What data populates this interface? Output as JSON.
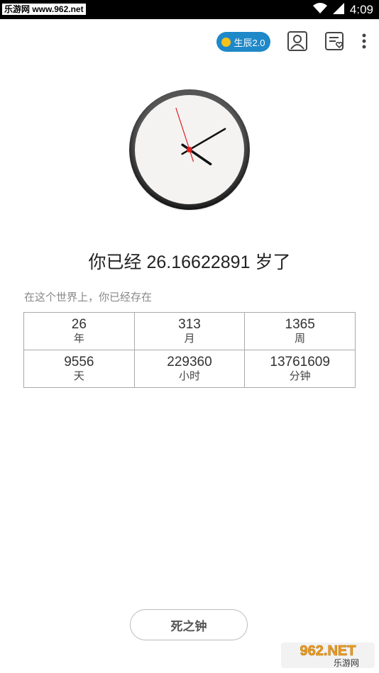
{
  "status_bar": {
    "source_label": "乐游网 www.962.net",
    "time": "4:09"
  },
  "toolbar": {
    "badge_label": "生辰2.0"
  },
  "age": {
    "prefix": "你已经",
    "value": "26.16622891",
    "suffix": "岁了"
  },
  "subtitle": "在这个世界上，你已经存在",
  "stats": [
    [
      {
        "value": "26",
        "unit": "年"
      },
      {
        "value": "313",
        "unit": "月"
      },
      {
        "value": "1365",
        "unit": "周"
      }
    ],
    [
      {
        "value": "9556",
        "unit": "天"
      },
      {
        "value": "229360",
        "unit": "小时"
      },
      {
        "value": "13761609",
        "unit": "分钟"
      }
    ]
  ],
  "bottom_button": "死之钟",
  "watermark": {
    "brand": "962.NET",
    "sub": "乐游网"
  },
  "clock": {
    "hour": 4,
    "minute": 9,
    "second": 57
  },
  "colors": {
    "badge": "#1e88c8",
    "badge_dot": "#f6c21a",
    "second_hand": "#e02020"
  }
}
